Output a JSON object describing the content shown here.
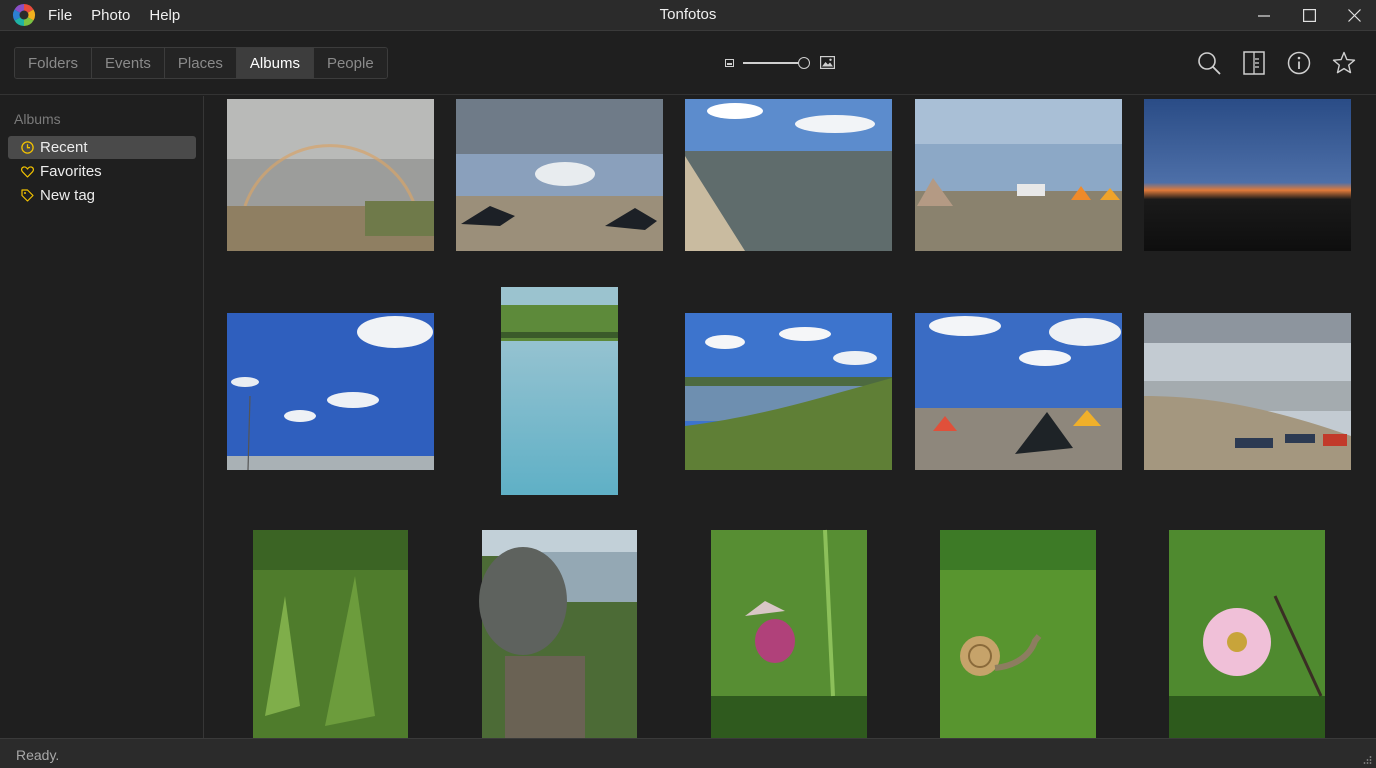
{
  "app": {
    "title": "Tonfotos",
    "logo_icon": "tonfotos-logo-icon"
  },
  "menu": [
    "File",
    "Photo",
    "Help"
  ],
  "window_controls": [
    "minimize-icon",
    "maximize-icon",
    "close-icon"
  ],
  "tabs": [
    {
      "label": "Folders",
      "active": false
    },
    {
      "label": "Events",
      "active": false
    },
    {
      "label": "Places",
      "active": false
    },
    {
      "label": "Albums",
      "active": true
    },
    {
      "label": "People",
      "active": false
    }
  ],
  "zoom": {
    "level": 0.95,
    "small_icon": "small-image-icon",
    "large_icon": "large-image-icon"
  },
  "toolbar_icons": [
    "search-icon",
    "panel-icon",
    "info-icon",
    "star-icon"
  ],
  "sidebar": {
    "heading": "Albums",
    "items": [
      {
        "label": "Recent",
        "icon": "clock-icon",
        "selected": true
      },
      {
        "label": "Favorites",
        "icon": "heart-icon",
        "selected": false
      },
      {
        "label": "New tag",
        "icon": "tag-icon",
        "selected": false
      }
    ]
  },
  "photos": [
    {
      "name": "rainbow-beach",
      "sky": "#a5a8a6",
      "ground": "#9a8c73"
    },
    {
      "name": "kites-on-sand",
      "sky": "#8fa3bc",
      "ground": "#958a78"
    },
    {
      "name": "lagoon-shore",
      "sky": "#5f8fcf",
      "ground": "#5a6a6a"
    },
    {
      "name": "camp-tents",
      "sky": "#8ea9c8",
      "ground": "#8a8470"
    },
    {
      "name": "dusk-camp",
      "sky": "#2c4a7a",
      "ground": "#121212"
    },
    {
      "name": "blue-sky-kites",
      "sky": "#2f60c0",
      "ground": "#a8b0b6"
    },
    {
      "name": "lake-vertical",
      "sky": "#8fb9c6",
      "ground": "#7fbccc"
    },
    {
      "name": "reeds-lake",
      "sky": "#3f78d0",
      "ground": "#6d8a40"
    },
    {
      "name": "tents-clouds",
      "sky": "#3c6fc6",
      "ground": "#8f877a"
    },
    {
      "name": "kite-boards",
      "sky": "#c9d0d6",
      "ground": "#a59985"
    },
    {
      "name": "lily-leaves",
      "sky": "#5f8a3a",
      "ground": "#3e6b26"
    },
    {
      "name": "big-rock",
      "sky": "#a4b8c6",
      "ground": "#4f6b3a"
    },
    {
      "name": "lady-slipper",
      "sky": "#5f9a3a",
      "ground": "#3d6a24"
    },
    {
      "name": "snail-leaf",
      "sky": "#5e9a38",
      "ground": "#4c8a2c"
    },
    {
      "name": "wild-rose",
      "sky": "#5b8f35",
      "ground": "#3f7026"
    }
  ],
  "status": "Ready."
}
